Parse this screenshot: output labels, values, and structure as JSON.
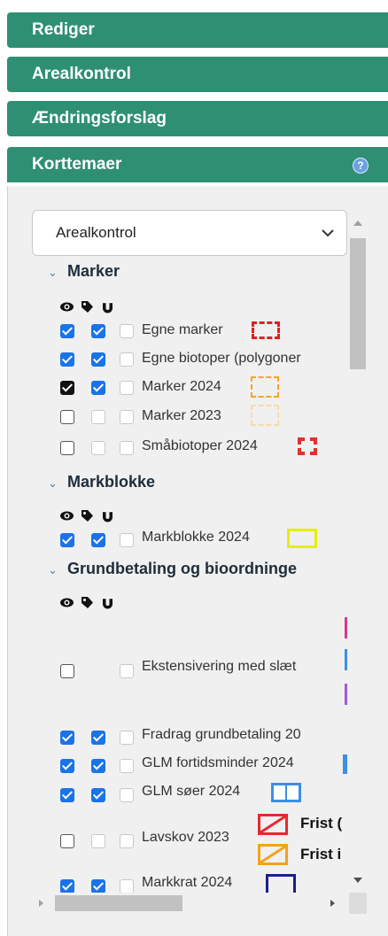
{
  "panels": [
    {
      "label": "Rediger"
    },
    {
      "label": "Arealkontrol"
    },
    {
      "label": "Ændringsforslag"
    },
    {
      "label": "Korttemaer"
    }
  ],
  "help_glyph": "?",
  "dropdown": {
    "selected": "Arealkontrol"
  },
  "groups": [
    {
      "title": "Marker",
      "layers": [
        {
          "label": "Egne marker",
          "visible": true,
          "labels": true,
          "snap": false,
          "swatch_color": "#e02020"
        },
        {
          "label": "Egne biotoper (polygoner",
          "visible": true,
          "labels": true,
          "snap": false,
          "swatch_color": ""
        },
        {
          "label": "Marker 2024",
          "visible": true,
          "labels": true,
          "snap": false,
          "swatch_color": "#f6a623"
        },
        {
          "label": "Marker 2023",
          "visible": false,
          "labels": false,
          "snap": false,
          "swatch_color": "#fbd9a8"
        },
        {
          "label": "Småbiotoper 2024",
          "visible": false,
          "labels": false,
          "snap": false,
          "swatch_color": "#e03030"
        }
      ]
    },
    {
      "title": "Markblokke",
      "layers": [
        {
          "label": "Markblokke 2024",
          "visible": true,
          "labels": true,
          "snap": false,
          "swatch_color": "#e6ef00"
        }
      ]
    },
    {
      "title": "Grundbetaling og bioordninge",
      "layers": [
        {
          "label": "Ekstensivering med slæt",
          "visible": false,
          "labels": false,
          "snap": false,
          "swatch_color": ""
        },
        {
          "label": "Fradrag grundbetaling 20",
          "visible": true,
          "labels": true,
          "snap": false,
          "swatch_color": ""
        },
        {
          "label": "GLM fortidsminder 2024",
          "visible": true,
          "labels": true,
          "snap": false,
          "swatch_color": "#3b8fe6"
        },
        {
          "label": "GLM søer 2024",
          "visible": true,
          "labels": true,
          "snap": false,
          "swatch_color": "#3b8fe6"
        },
        {
          "label": "Lavskov 2023",
          "visible": false,
          "labels": false,
          "snap": false,
          "swatch_color": ""
        },
        {
          "label": "Markkrat 2024",
          "visible": true,
          "labels": true,
          "snap": false,
          "swatch_color": "#1b1f8a"
        }
      ]
    }
  ],
  "lavskov_legend": [
    {
      "text": "Frist (",
      "color": "#e8282e"
    },
    {
      "text": "Frist i",
      "color": "#f4a21c"
    }
  ]
}
